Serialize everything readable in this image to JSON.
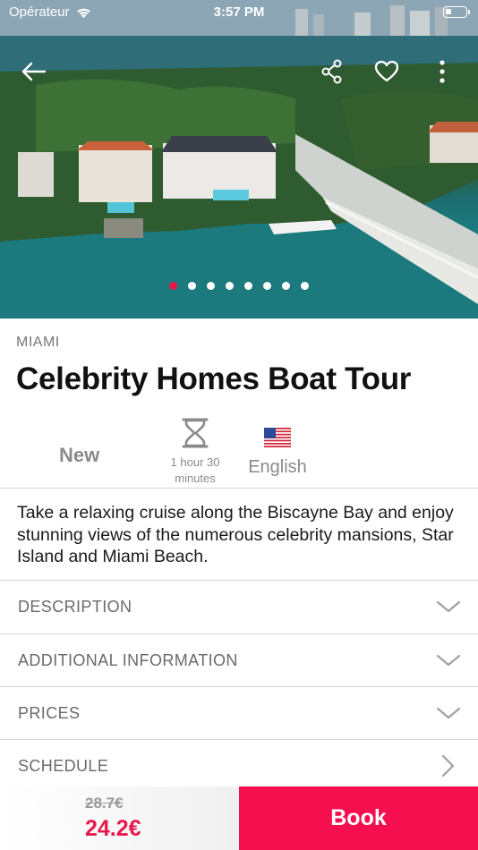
{
  "status_bar": {
    "carrier": "Opérateur",
    "time": "3:57 PM"
  },
  "hero": {
    "slide_count": 8,
    "active_slide": 1
  },
  "tour": {
    "city": "MIAMI",
    "title": "Celebrity Homes Boat Tour",
    "badge": "New",
    "duration_line1": "1 hour 30",
    "duration_line2": "minutes",
    "language": "English",
    "description": "Take a relaxing cruise along the Biscayne Bay and enjoy stunning views of the numerous celebrity mansions, Star Island and Miami Beach."
  },
  "sections": [
    {
      "label": "DESCRIPTION",
      "icon": "chevron-down-icon"
    },
    {
      "label": "ADDITIONAL INFORMATION",
      "icon": "chevron-down-icon"
    },
    {
      "label": "PRICES",
      "icon": "chevron-down-icon"
    },
    {
      "label": "SCHEDULE",
      "icon": "chevron-right-icon"
    }
  ],
  "pricing": {
    "old_price": "28.7€",
    "new_price": "24.2€",
    "book_label": "Book"
  },
  "colors": {
    "accent": "#f50f4f",
    "muted_text": "#8a8a8a",
    "divider": "#d4d4d4"
  }
}
